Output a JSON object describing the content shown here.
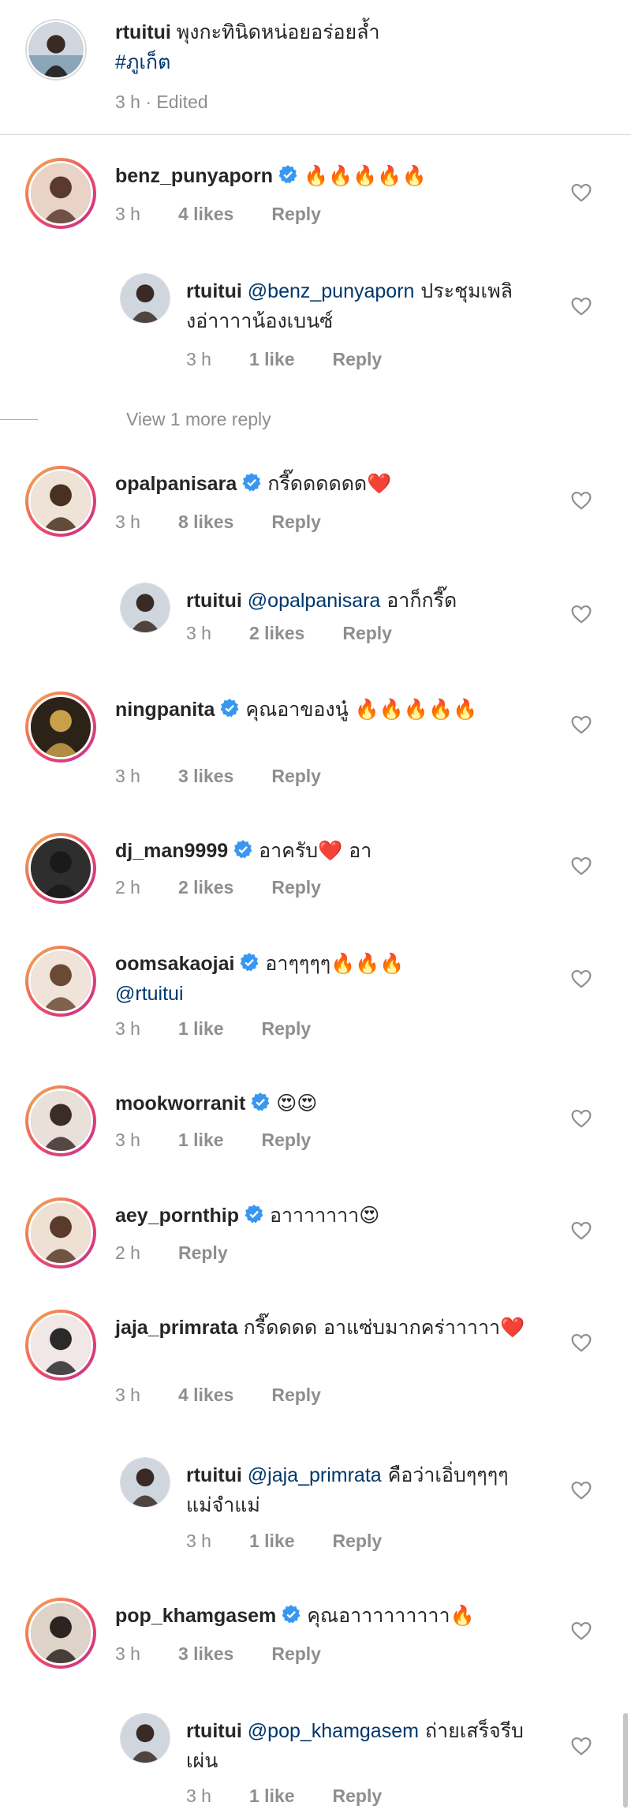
{
  "caption": {
    "username": "rtuitui",
    "text": "พุงกะทินิดหน่อยอร่อยล้ำ",
    "hashtag": "#ภูเก็ต",
    "meta": "3 h · Edited"
  },
  "view_more": "View 1 more reply",
  "labels": {
    "reply": "Reply"
  },
  "comments": [
    {
      "username": "benz_punyaporn",
      "text": "🔥🔥🔥🔥🔥",
      "time": "3 h",
      "likes": "4 likes"
    },
    {
      "username": "rtuitui",
      "mention": "@benz_punyaporn",
      "text": " ประชุมเพลิงอ่าาาาน้องเบนซ์",
      "time": "3 h",
      "likes": "1 like"
    },
    {
      "username": "opalpanisara",
      "text": "กรี๊ดดดดดด❤️",
      "time": "3 h",
      "likes": "8 likes"
    },
    {
      "username": "rtuitui",
      "mention": "@opalpanisara",
      "text": " อาก็กรี๊ด",
      "time": "3 h",
      "likes": "2 likes"
    },
    {
      "username": "ningpanita",
      "text": "คุณอาของนู๋ 🔥🔥🔥🔥🔥",
      "time": "3 h",
      "likes": "3 likes"
    },
    {
      "username": "dj_man9999",
      "text": "อาครับ❤️ อา",
      "time": "2 h",
      "likes": "2 likes"
    },
    {
      "username": "oomsakaojai",
      "text": "อาๆๆๆๆ🔥🔥🔥",
      "mention_after": "@rtuitui",
      "time": "3 h",
      "likes": "1 like"
    },
    {
      "username": "mookworranit",
      "text": "😍😍",
      "time": "3 h",
      "likes": "1 like"
    },
    {
      "username": "aey_pornthip",
      "text": "อาาาาาาา😍",
      "time": "2 h",
      "likes": ""
    },
    {
      "username": "jaja_primrata",
      "text": "กรี๊ดดดด อาแซ่บมากคร่าาาาา❤️",
      "time": "3 h",
      "likes": "4 likes"
    },
    {
      "username": "rtuitui",
      "mention": "@jaja_primrata",
      "text": " คือว่าเอิ่บๆๆๆๆ แม่จำแม่",
      "time": "3 h",
      "likes": "1 like"
    },
    {
      "username": "pop_khamgasem",
      "text": "คุณอาาาาาาาาา🔥",
      "time": "3 h",
      "likes": "3 likes"
    },
    {
      "username": "rtuitui",
      "mention": "@pop_khamgasem",
      "text": " ถ่ายเสร็จรีบเผ่น",
      "time": "3 h",
      "likes": "1 like"
    }
  ]
}
